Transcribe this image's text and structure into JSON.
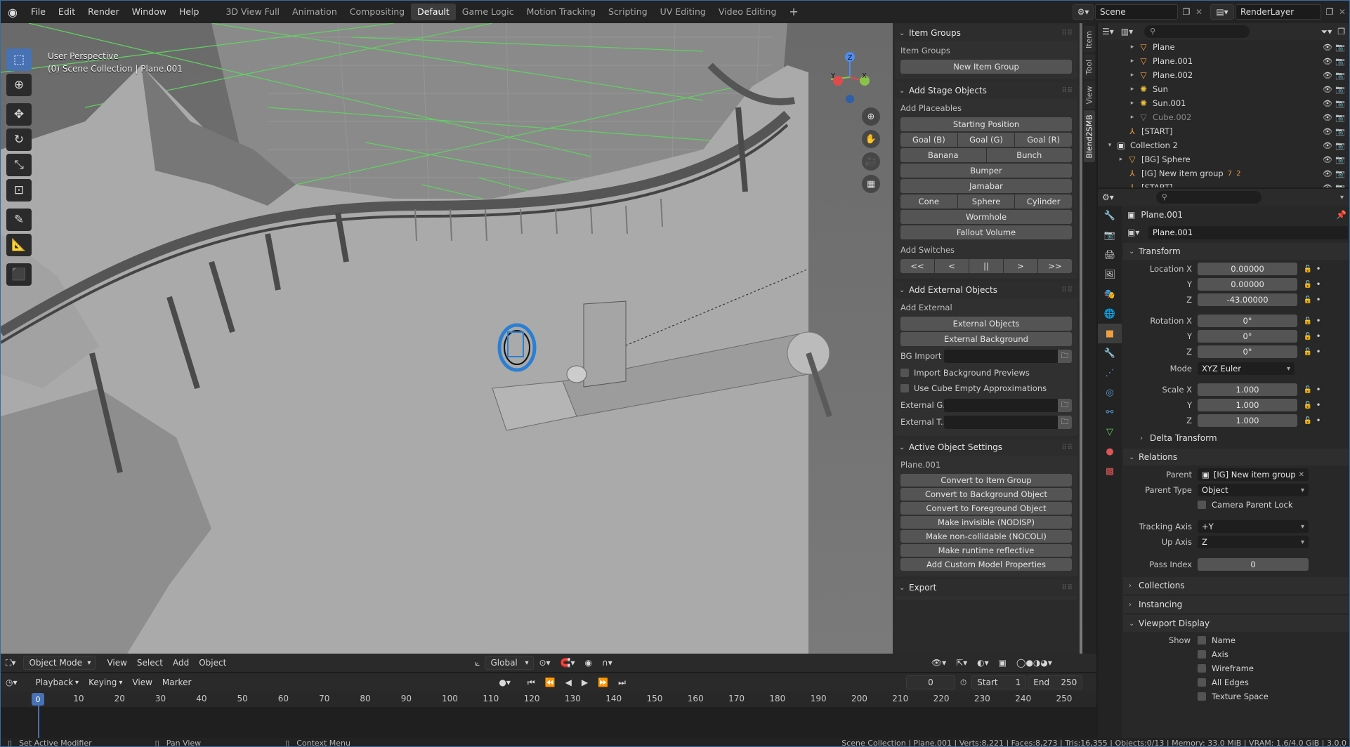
{
  "menu": [
    "File",
    "Edit",
    "Render",
    "Window",
    "Help"
  ],
  "workspaces": [
    "3D View Full",
    "Animation",
    "Compositing",
    "Default",
    "Game Logic",
    "Motion Tracking",
    "Scripting",
    "UV Editing",
    "Video Editing"
  ],
  "active_workspace": "Default",
  "scene_name": "Scene",
  "view_layer": "RenderLayer",
  "viewport": {
    "perspective": "User Perspective",
    "collection_info": "(0) Scene Collection | Plane.001",
    "gizmo_axes": {
      "x": "X",
      "y": "Y",
      "z": "Z"
    }
  },
  "npanel": {
    "side_tabs": [
      "Item",
      "Tool",
      "View",
      "Blend2SMB"
    ],
    "item_groups": {
      "title": "Item Groups",
      "label": "Item Groups",
      "new_button": "New Item Group"
    },
    "stage_objects": {
      "title": "Add Stage Objects",
      "placeables_label": "Add Placeables",
      "starting_position": "Starting Position",
      "goals": [
        "Goal (B)",
        "Goal (G)",
        "Goal (R)"
      ],
      "banana": [
        "Banana",
        "Bunch"
      ],
      "bumper": "Bumper",
      "jamabar": "Jamabar",
      "shapes": [
        "Cone",
        "Sphere",
        "Cylinder"
      ],
      "wormhole": "Wormhole",
      "fallout": "Fallout Volume",
      "switches_label": "Add Switches",
      "switches": [
        "<<",
        "<",
        "||",
        ">",
        ">>"
      ]
    },
    "external_objects": {
      "title": "Add External Objects",
      "label": "Add External",
      "external_objects_btn": "External Objects",
      "external_background_btn": "External Background",
      "bg_import_label": "BG Import ...",
      "import_previews": "Import Background Previews",
      "cube_empty": "Use Cube Empty Approximations",
      "ext_g_label": "External G...",
      "ext_t_label": "External T..."
    },
    "active_object": {
      "title": "Active Object Settings",
      "object_name": "Plane.001",
      "buttons": [
        "Convert to Item Group",
        "Convert to Background Object",
        "Convert to Foreground Object",
        "Make invisible (NODISP)",
        "Make non-collidable (NOCOLI)",
        "Make runtime reflective",
        "Add Custom Model Properties"
      ]
    },
    "export": {
      "title": "Export"
    }
  },
  "viewport_header": {
    "mode": "Object Mode",
    "menus": [
      "View",
      "Select",
      "Add",
      "Object"
    ],
    "orientation": "Global"
  },
  "timeline_header": {
    "menus": [
      "Playback",
      "Keying",
      "View",
      "Marker"
    ],
    "current_frame": "0",
    "start_label": "Start",
    "start": "1",
    "end_label": "End",
    "end": "250"
  },
  "timeline_ticks": [
    "0",
    "10",
    "20",
    "30",
    "40",
    "50",
    "60",
    "70",
    "80",
    "90",
    "100",
    "110",
    "120",
    "130",
    "140",
    "150",
    "160",
    "170",
    "180",
    "190",
    "200",
    "210",
    "220",
    "230",
    "240",
    "250"
  ],
  "statusbar": {
    "left": [
      "Set Active Modifier",
      "Pan View",
      "Context Menu"
    ],
    "right": "Scene Collection | Plane.001 | Verts:8,221 | Faces:8,273 | Tris:16,355 | Objects:0/13 | Memory: 33.0 MiB | VRAM: 1.6/4.0 GiB | 3.0.0"
  },
  "outliner": {
    "rows": [
      {
        "name": "Plane",
        "indent": 3,
        "icon": "mesh",
        "dim": false
      },
      {
        "name": "Plane.001",
        "indent": 3,
        "icon": "mesh",
        "dim": false
      },
      {
        "name": "Plane.002",
        "indent": 3,
        "icon": "mesh",
        "dim": false
      },
      {
        "name": "Sun",
        "indent": 3,
        "icon": "light",
        "dim": false
      },
      {
        "name": "Sun.001",
        "indent": 3,
        "icon": "light",
        "dim": false
      },
      {
        "name": "Cube.002",
        "indent": 3,
        "icon": "mesh",
        "dim": true
      },
      {
        "name": "[START]",
        "indent": 2,
        "icon": "empty",
        "dim": false
      },
      {
        "name": "Collection 2",
        "indent": 1,
        "icon": "collection",
        "dim": false
      },
      {
        "name": "[BG] Sphere",
        "indent": 2,
        "icon": "mesh",
        "dim": false
      },
      {
        "name": "[IG] New item group",
        "indent": 2,
        "icon": "empty",
        "dim": false
      },
      {
        "name": "[START]",
        "indent": 2,
        "icon": "empty",
        "dim": false
      }
    ],
    "ig_badges": [
      "7",
      "2"
    ]
  },
  "properties": {
    "object_name": "Plane.001",
    "name_field": "Plane.001",
    "transform": {
      "title": "Transform",
      "location_label": "Location X",
      "location": [
        "0.00000",
        "0.00000",
        "-43.00000"
      ],
      "rotation_label": "Rotation X",
      "rotation": [
        "0°",
        "0°",
        "0°"
      ],
      "mode_label": "Mode",
      "mode": "XYZ Euler",
      "scale_label": "Scale X",
      "scale": [
        "1.000",
        "1.000",
        "1.000"
      ],
      "y_label": "Y",
      "z_label": "Z",
      "delta": "Delta Transform"
    },
    "relations": {
      "title": "Relations",
      "parent_label": "Parent",
      "parent": "[IG] New item group",
      "parent_type_label": "Parent Type",
      "parent_type": "Object",
      "camera_lock": "Camera Parent Lock",
      "tracking_label": "Tracking Axis",
      "tracking": "+Y",
      "up_label": "Up Axis",
      "up": "Z",
      "pass_label": "Pass Index",
      "pass": "0"
    },
    "collections": "Collections",
    "instancing": "Instancing",
    "viewport_display": {
      "title": "Viewport Display",
      "show_label": "Show",
      "options": [
        "Name",
        "Axis",
        "Wireframe",
        "All Edges",
        "Texture Space"
      ]
    }
  },
  "colors": {
    "accent": "#4772b3",
    "grid_green": "#5fd35f",
    "viewport_bg": "#6d6d6d"
  }
}
